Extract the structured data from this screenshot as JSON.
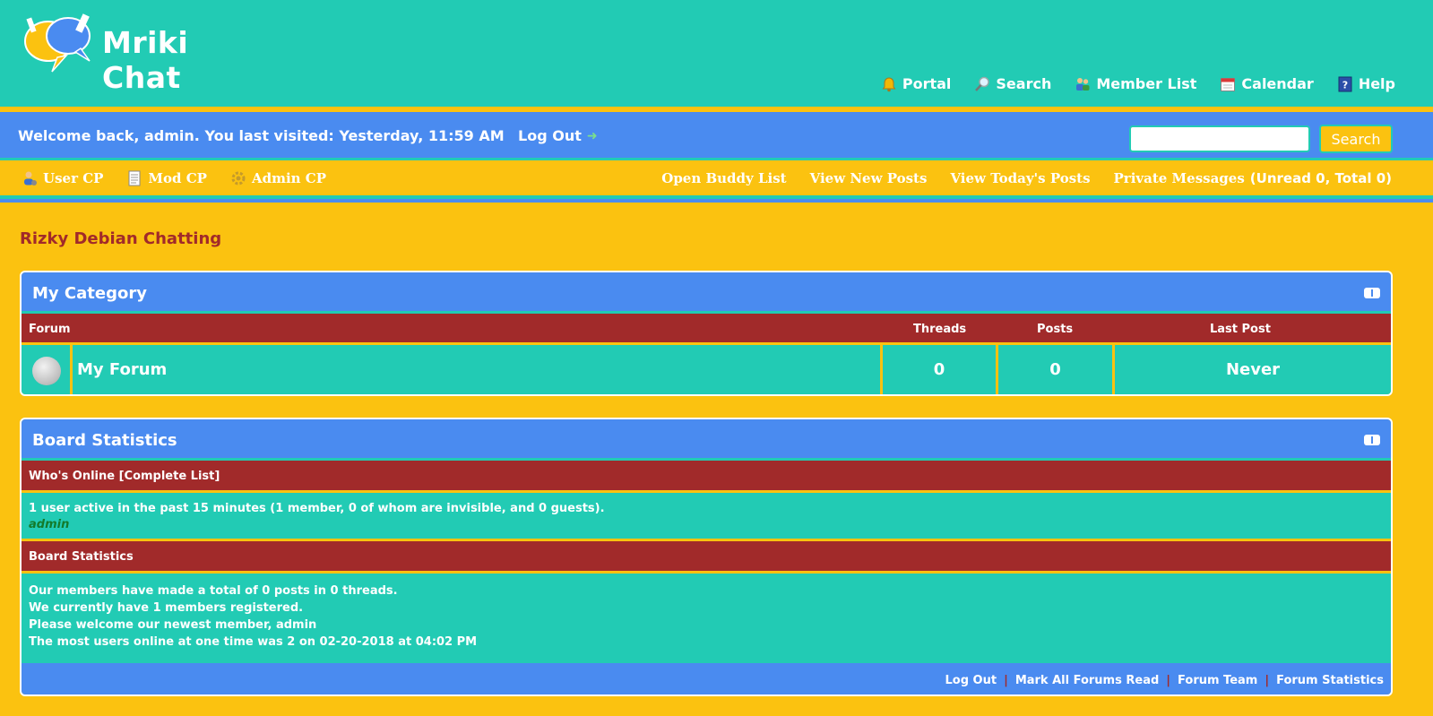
{
  "header": {
    "logo_text": "Mriki Chat",
    "nav": [
      {
        "label": "Portal",
        "icon": "bell-icon"
      },
      {
        "label": "Search",
        "icon": "magnifier-icon"
      },
      {
        "label": "Member List",
        "icon": "members-icon"
      },
      {
        "label": "Calendar",
        "icon": "calendar-icon"
      },
      {
        "label": "Help",
        "icon": "help-icon"
      }
    ]
  },
  "welcome": {
    "text": "Welcome back, admin. You last visited: Yesterday, 11:59 AM",
    "logout_label": "Log Out",
    "search_placeholder": "",
    "search_button": "Search"
  },
  "panel": {
    "left": [
      {
        "label": "User CP",
        "icon": "user-icon"
      },
      {
        "label": "Mod CP",
        "icon": "notepad-icon"
      },
      {
        "label": "Admin CP",
        "icon": "gear-icon"
      }
    ],
    "right": [
      {
        "label": "Open Buddy List"
      },
      {
        "label": "View New Posts"
      },
      {
        "label": "View Today's Posts"
      },
      {
        "label": "Private Messages"
      }
    ],
    "pm_counts": "(Unread 0, Total 0)"
  },
  "board_title": "Rizky Debian Chatting",
  "category": {
    "title": "My Category",
    "columns": [
      "Forum",
      "Threads",
      "Posts",
      "Last Post"
    ],
    "forums": [
      {
        "name": "My Forum",
        "threads": "0",
        "posts": "0",
        "last_post": "Never"
      }
    ]
  },
  "stats": {
    "title": "Board Statistics",
    "online_head": "Who's Online [Complete List]",
    "online_text": "1 user active in the past 15 minutes (1 member, 0 of whom are invisible, and 0 guests).",
    "online_user": "admin",
    "stats_head": "Board Statistics",
    "lines": [
      "Our members have made a total of 0 posts in 0 threads.",
      "We currently have 1 members registered.",
      "Please welcome our newest member, admin",
      "The most users online at one time was 2 on 02-20-2018 at 04:02 PM"
    ],
    "footer_links": [
      "Log Out",
      "Mark All Forums Read",
      "Forum Team",
      "Forum Statistics"
    ]
  },
  "colors": {
    "teal": "#22cbb4",
    "blue": "#4a8bf0",
    "yellow": "#fbc210",
    "maroon": "#a12a2a"
  }
}
